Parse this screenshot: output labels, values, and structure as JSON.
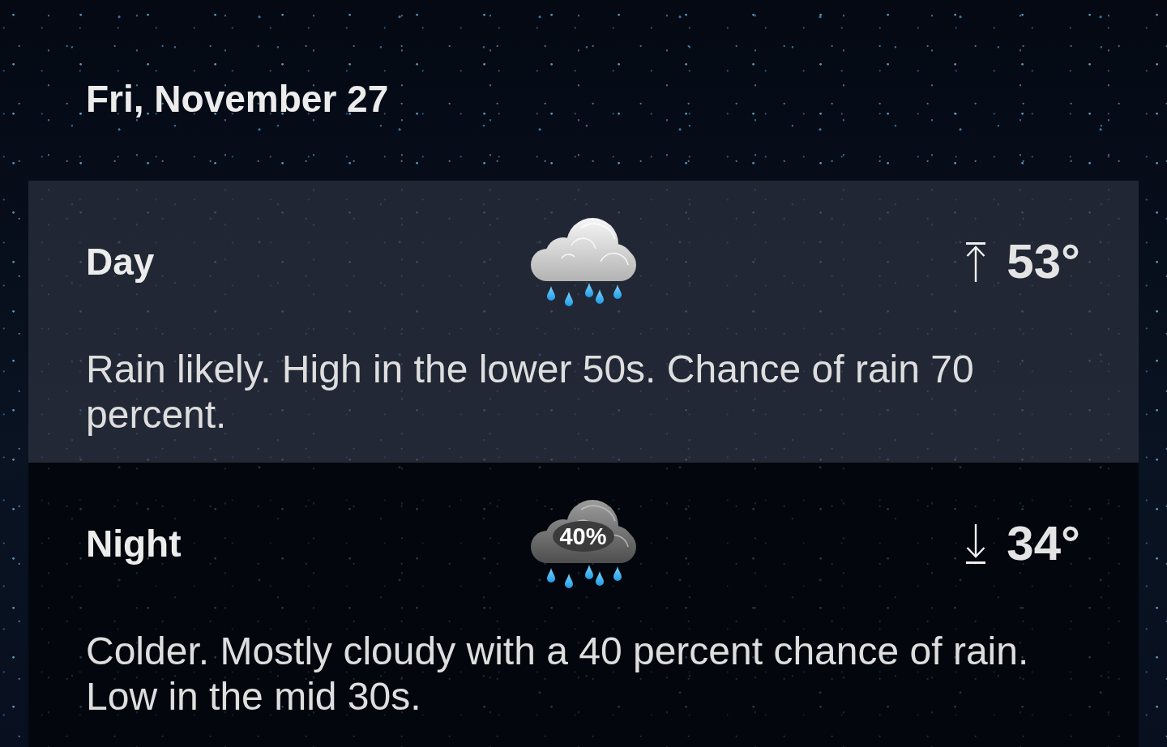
{
  "date": "Fri, November 27",
  "periods": [
    {
      "label": "Day",
      "selected": true,
      "kind": "rain",
      "temperature": {
        "kind": "high",
        "value": "53°"
      },
      "description": "Rain likely. High in the lower 50s. Chance of rain 70 percent."
    },
    {
      "label": "Night",
      "selected": false,
      "kind": "rain_chance",
      "precip_chance": "40%",
      "temperature": {
        "kind": "low",
        "value": "34°"
      },
      "description": "Colder. Mostly cloudy with a 40 percent chance of rain. Low in the mid 30s."
    }
  ]
}
